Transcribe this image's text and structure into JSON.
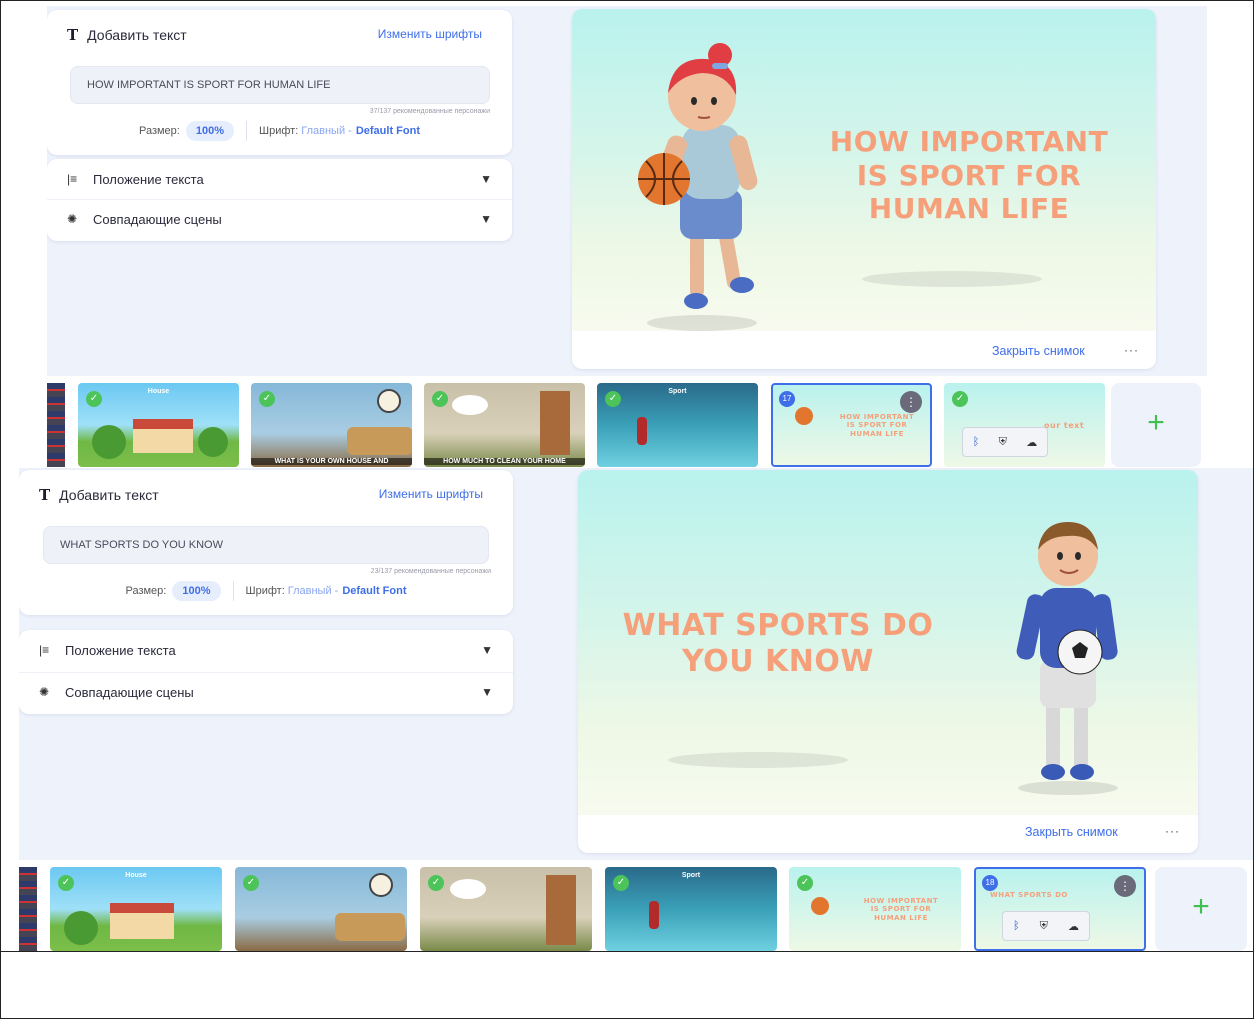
{
  "editor": {
    "add_text_label": "Добавить текст",
    "change_fonts_link": "Изменить шрифты",
    "size_label": "Размер:",
    "size_value": "100%",
    "font_label": "Шрифт:",
    "font_category": "Главный -",
    "font_name": "Default Font",
    "text_position_label": "Положение текста",
    "matching_scenes_label": "Совпадающие сцены"
  },
  "preview": {
    "close_snapshot_label": "Закрыть снимок",
    "more_label": "···"
  },
  "panel1": {
    "text_value": "HOW IMPORTANT IS SPORT FOR HUMAN LIFE",
    "counter": "37/137 рекомендованные персонажи",
    "scene_title_line1": "HOW IMPORTANT",
    "scene_title_line2": "IS SPORT FOR",
    "scene_title_line3": "HUMAN LIFE"
  },
  "panel2": {
    "text_value": "WHAT SPORTS DO YOU KNOW",
    "counter": "23/137 рекомендованные персонажи",
    "scene_title_line1": "WHAT SPORTS DO",
    "scene_title_line2": "YOU KNOW"
  },
  "strip1": {
    "thumb_house_label": "House",
    "thumb2_caption": "WHAT IS YOUR OWN HOUSE AND",
    "thumb3_caption": "HOW MUCH TO CLEAN YOUR HOME",
    "thumb4_label": "Sport",
    "thumb5_badge": "17",
    "thumb5_title_line1": "HOW IMPORTANT",
    "thumb5_title_line2": "IS SPORT FOR",
    "thumb5_title_line3": "HUMAN LIFE",
    "thumb6_partial": "our text",
    "add_symbol": "+"
  },
  "strip2": {
    "thumb_house_label": "House",
    "thumb4_label": "Sport",
    "thumb5_title_line1": "HOW IMPORTANT",
    "thumb5_title_line2": "IS SPORT FOR",
    "thumb5_title_line3": "HUMAN LIFE",
    "thumb6_badge": "18",
    "thumb6_partial": "WHAT SPORTS DO",
    "add_symbol": "+"
  },
  "colors": {
    "accent": "#3e6ee8",
    "title_orange": "#f5a07b",
    "check_green": "#4cc45a",
    "panel_bg": "#eef2fb"
  },
  "icons": [
    "text-t-icon",
    "align-left-icon",
    "brain-icon",
    "chevron-down-icon",
    "check-icon",
    "more-icon",
    "plus-icon",
    "bluetooth-icon",
    "shield-icon",
    "cloud-icon"
  ]
}
